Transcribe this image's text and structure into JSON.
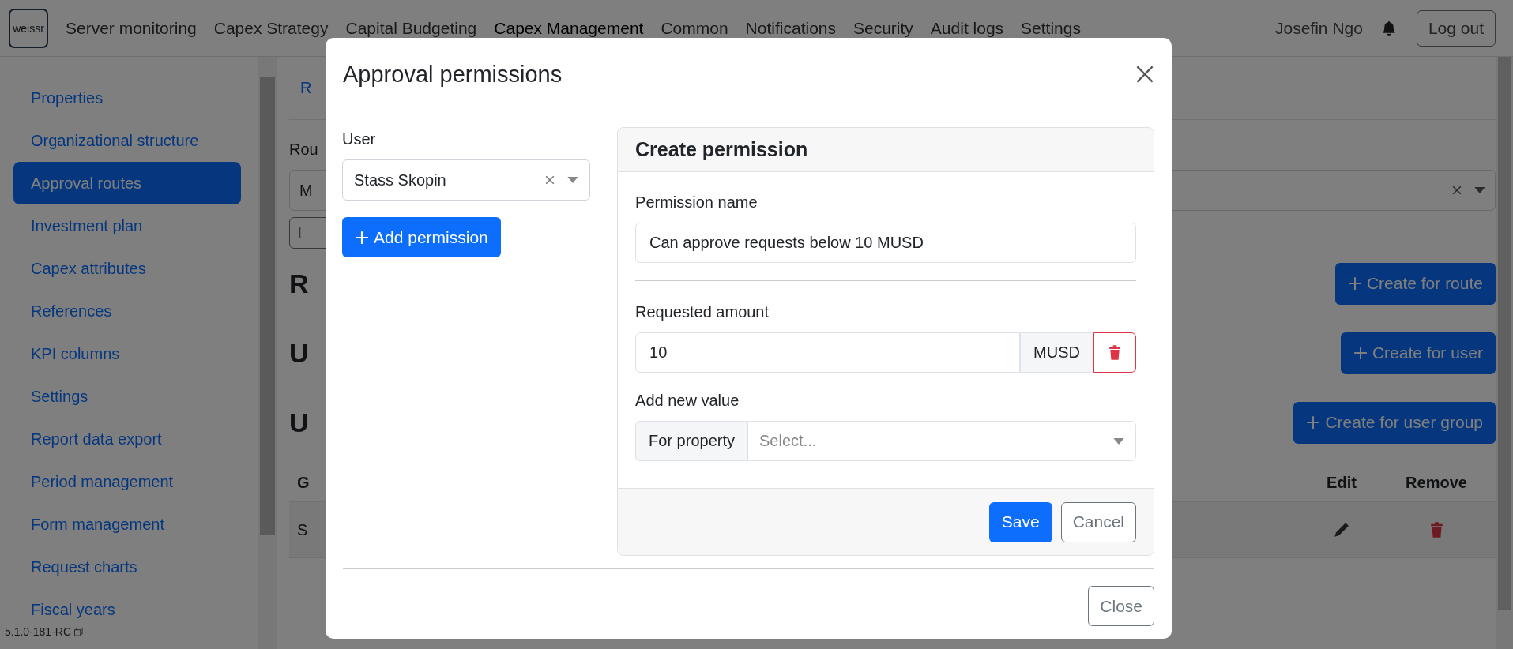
{
  "navbar": {
    "logo": "weissr",
    "items": [
      {
        "label": "Server monitoring",
        "selected": false
      },
      {
        "label": "Capex Strategy",
        "selected": false
      },
      {
        "label": "Capital Budgeting",
        "selected": false
      },
      {
        "label": "Capex Management",
        "selected": true
      },
      {
        "label": "Common",
        "selected": false
      },
      {
        "label": "Notifications",
        "selected": false
      },
      {
        "label": "Security",
        "selected": false
      },
      {
        "label": "Audit logs",
        "selected": false
      },
      {
        "label": "Settings",
        "selected": false
      }
    ],
    "user": "Josefin Ngo",
    "logout": "Log out"
  },
  "sidebar": {
    "items": [
      {
        "label": "Properties",
        "selected": false
      },
      {
        "label": "Organizational structure",
        "selected": false
      },
      {
        "label": "Approval routes",
        "selected": true
      },
      {
        "label": "Investment plan",
        "selected": false
      },
      {
        "label": "Capex attributes",
        "selected": false
      },
      {
        "label": "References",
        "selected": false
      },
      {
        "label": "KPI columns",
        "selected": false
      },
      {
        "label": "Settings",
        "selected": false
      },
      {
        "label": "Report data export",
        "selected": false
      },
      {
        "label": "Period management",
        "selected": false
      },
      {
        "label": "Form management",
        "selected": false
      },
      {
        "label": "Request charts",
        "selected": false
      },
      {
        "label": "Fiscal years",
        "selected": false
      }
    ],
    "version": "5.1.0-181-RC"
  },
  "background": {
    "tab": "R",
    "route_label": "Rou",
    "route_select": "M",
    "import_field": "I",
    "sections": [
      {
        "heading": "R",
        "button": "Create for route"
      },
      {
        "heading": "U",
        "button": "Create for user"
      },
      {
        "heading": "U",
        "button": "Create for user group"
      }
    ],
    "table": {
      "columns": [
        "G",
        "Edit",
        "Remove"
      ],
      "rows": [
        {
          "cells": [
            "S"
          ]
        }
      ]
    }
  },
  "modal": {
    "title": "Approval permissions",
    "user_label": "User",
    "user_value": "Stass Skopin",
    "add_button": "Add permission",
    "card": {
      "title": "Create permission",
      "name_label": "Permission name",
      "name_value": "Can approve requests below 10 MUSD",
      "amount_label": "Requested amount",
      "amount_value": "10",
      "amount_unit": "MUSD",
      "new_value_label": "Add new value",
      "property_label": "For property",
      "property_placeholder": "Select...",
      "save": "Save",
      "cancel": "Cancel"
    },
    "close": "Close"
  }
}
